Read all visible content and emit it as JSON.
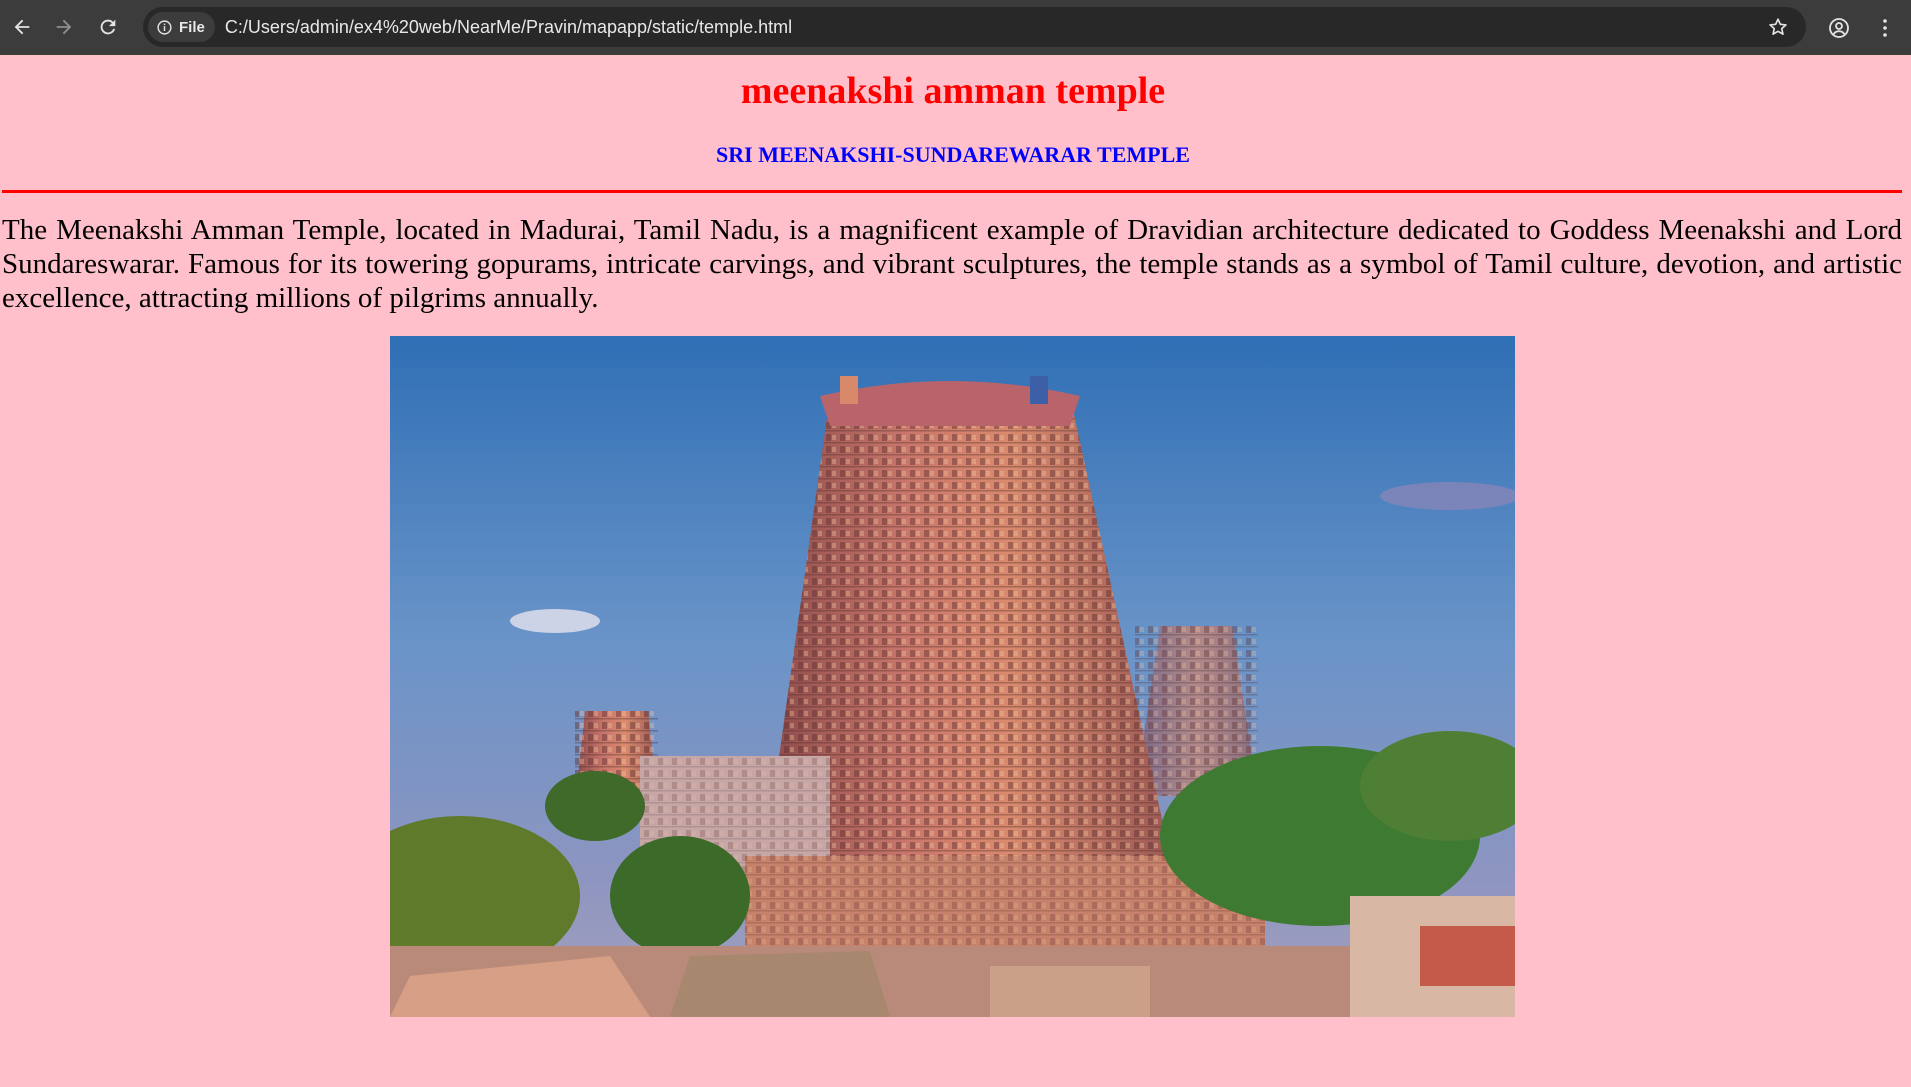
{
  "browser": {
    "site_chip_label": "File",
    "url": "C:/Users/admin/ex4%20web/NearMe/Pravin/mapapp/static/temple.html",
    "icons": [
      "back-arrow-icon",
      "forward-arrow-icon",
      "reload-icon",
      "info-icon",
      "star-icon",
      "profile-icon",
      "kebab-menu-icon"
    ]
  },
  "page": {
    "background_color": "#ffc0cb",
    "title": "meenakshi amman temple",
    "title_color": "#ff0000",
    "subtitle": "SRI MEENAKSHI-SUNDAREWARAR TEMPLE",
    "subtitle_color": "#0000ff",
    "rule_color": "#ff0000",
    "description": "The Meenakshi Amman Temple, located in Madurai, Tamil Nadu, is a magnificent example of Dravidian architecture dedicated to Goddess Meenakshi and Lord Sundareswarar. Famous for its towering gopurams, intricate carvings, and vibrant sculptures, the temple stands as a symbol of Tamil culture, devotion, and artistic excellence, attracting millions of pilgrims annually."
  }
}
